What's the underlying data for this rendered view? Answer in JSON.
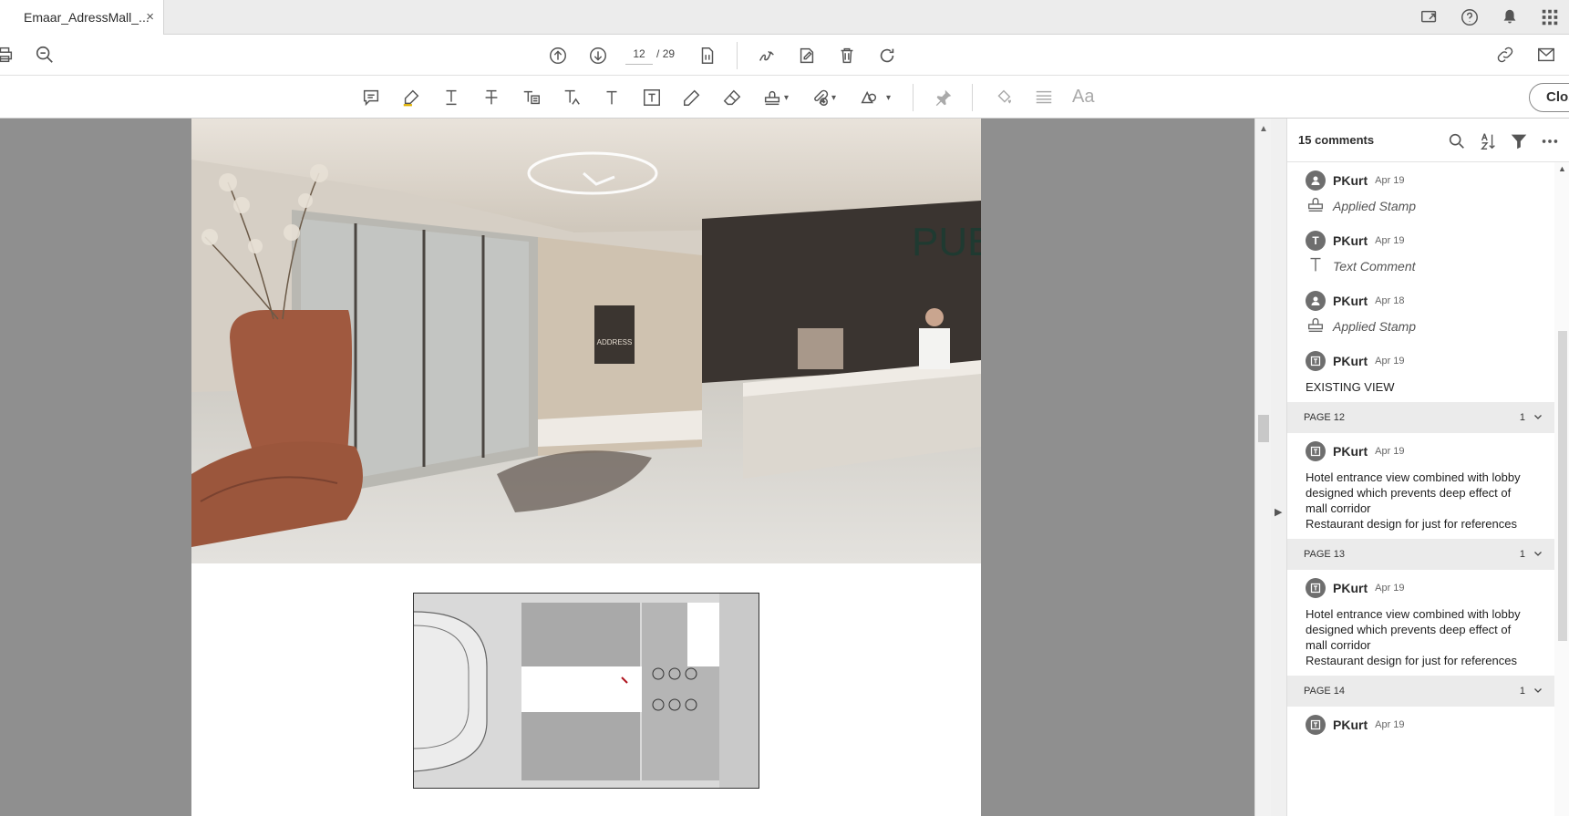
{
  "tab": {
    "title": "Emaar_AdressMall_...",
    "close": "×"
  },
  "toolbar": {
    "current_page": "12",
    "page_sep": "/",
    "total_pages": "29",
    "close_label": "Clos"
  },
  "panel": {
    "count": "15 comments",
    "items": [
      {
        "author": "PKurt",
        "date": "Apr 19",
        "avatar_letter": "",
        "type": "Applied Stamp",
        "body": ""
      },
      {
        "author": "PKurt",
        "date": "Apr 19",
        "avatar_letter": "T",
        "type": "Text Comment",
        "body": ""
      },
      {
        "author": "PKurt",
        "date": "Apr 18",
        "avatar_letter": "",
        "type": "Applied Stamp",
        "body": ""
      },
      {
        "author": "PKurt",
        "date": "Apr 19",
        "avatar_letter": "",
        "type": "",
        "body": "EXISTING VIEW"
      }
    ],
    "groups": [
      {
        "label": "PAGE 12",
        "count": "1",
        "item": {
          "author": "PKurt",
          "date": "Apr 19",
          "lines": [
            "Hotel entrance view combined with lobby",
            "designed which prevents deep effect of",
            "mall corridor",
            "Restaurant design for just for references"
          ]
        }
      },
      {
        "label": "PAGE 13",
        "count": "1",
        "item": {
          "author": "PKurt",
          "date": "Apr 19",
          "lines": [
            "Hotel entrance view combined with lobby",
            "designed which prevents deep effect of",
            "mall corridor",
            "Restaurant design for just for references"
          ]
        }
      },
      {
        "label": "PAGE 14",
        "count": "1",
        "item": {
          "author": "PKurt",
          "date": "Apr 19",
          "lines": []
        }
      }
    ]
  },
  "render": {
    "sign_text": "ADDRESS",
    "pub_text": "PUB"
  },
  "colors": {
    "accent": "#2c2c2c",
    "viewer_bg": "#8f8f8f",
    "group_bg": "#ebebeb"
  }
}
